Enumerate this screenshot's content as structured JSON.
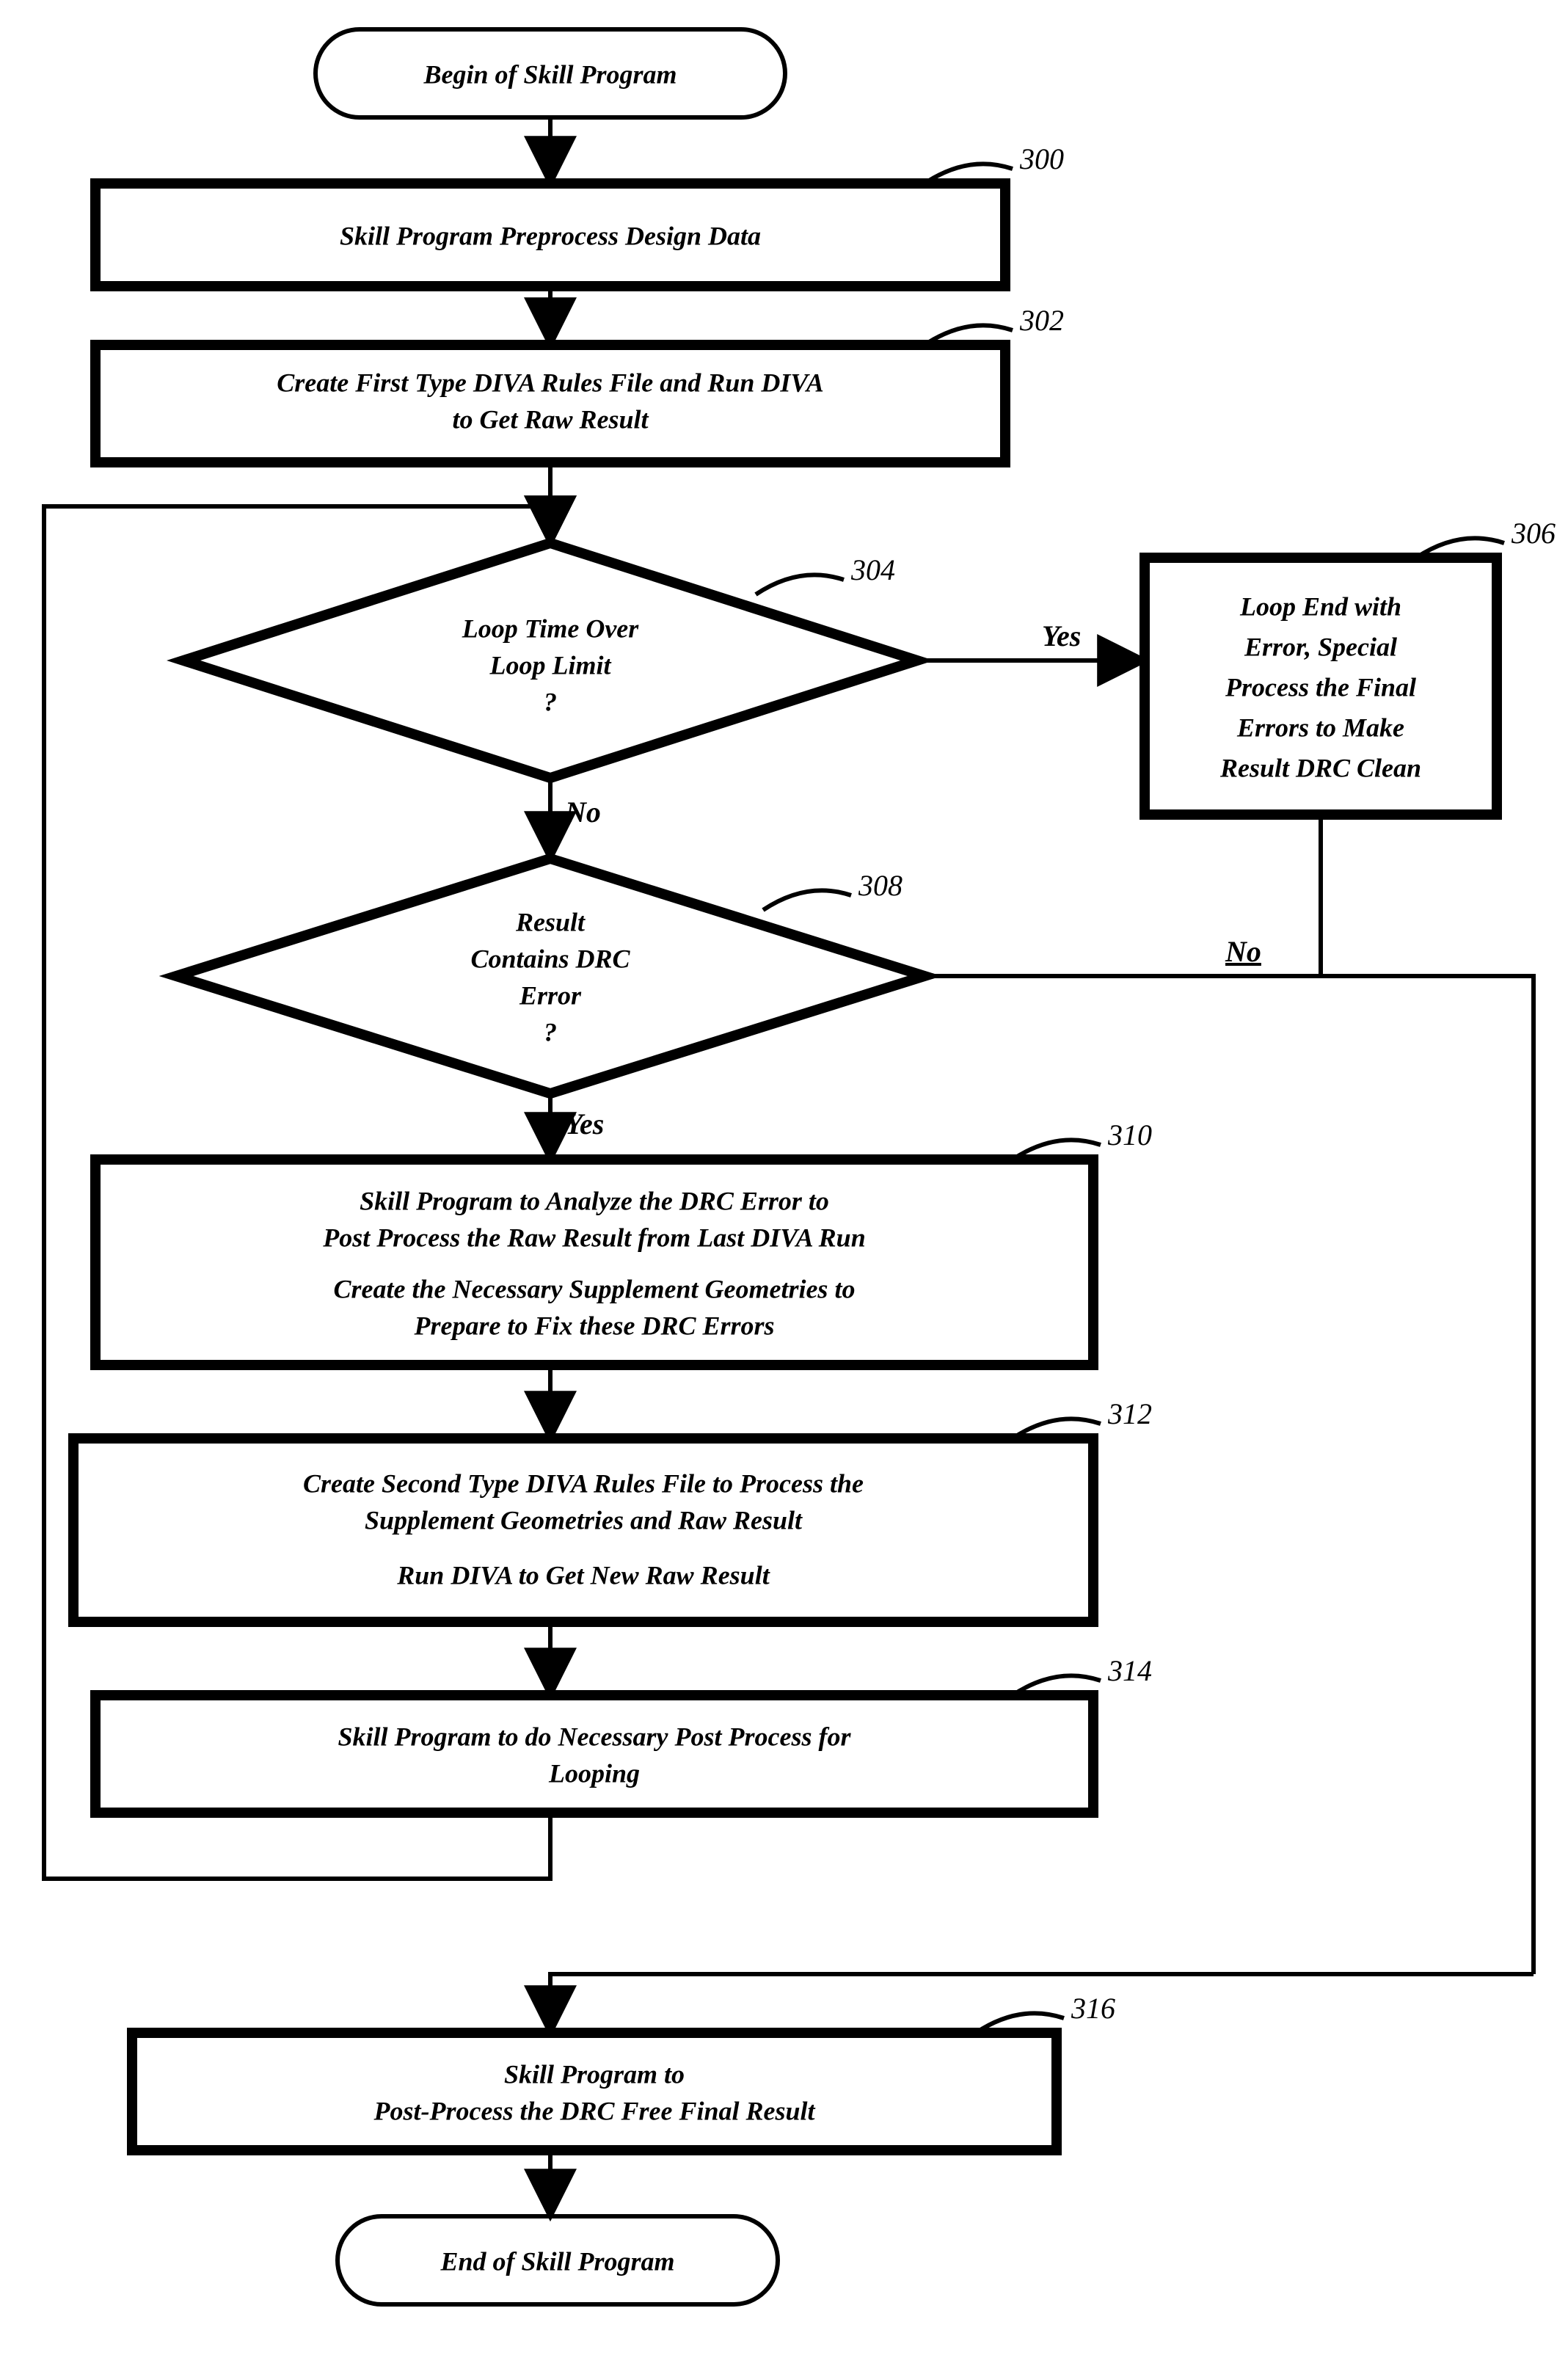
{
  "nodes": {
    "begin": {
      "text": "Begin of Skill Program"
    },
    "n300": {
      "ref": "300",
      "text": "Skill Program Preprocess Design Data"
    },
    "n302": {
      "ref": "302",
      "l1": "Create First Type DIVA Rules File and Run DIVA",
      "l2": "to Get Raw Result"
    },
    "n304": {
      "ref": "304",
      "l1": "Loop Time Over",
      "l2": "Loop Limit",
      "l3": "?"
    },
    "n306": {
      "ref": "306",
      "l1": "Loop End with",
      "l2": "Error, Special",
      "l3": "Process the Final",
      "l4": "Errors to Make",
      "l5": "Result DRC Clean"
    },
    "n308": {
      "ref": "308",
      "l1": "Result",
      "l2": "Contains DRC",
      "l3": "Error",
      "l4": "?"
    },
    "n310": {
      "ref": "310",
      "l1": "Skill Program to Analyze the DRC Error to",
      "l2": "Post Process the Raw Result from Last DIVA Run",
      "l3": "Create the Necessary Supplement Geometries to",
      "l4": "Prepare to Fix these DRC Errors"
    },
    "n312": {
      "ref": "312",
      "l1": "Create Second Type DIVA Rules File to Process the",
      "l2": "Supplement Geometries and Raw Result",
      "l3": "Run DIVA to Get New Raw Result"
    },
    "n314": {
      "ref": "314",
      "l1": "Skill Program to do Necessary Post Process for",
      "l2": "Looping"
    },
    "n316": {
      "ref": "316",
      "l1": "Skill Program to",
      "l2": "Post-Process the DRC Free Final Result"
    },
    "end": {
      "text": "End of Skill Program"
    }
  },
  "edges": {
    "yes": "Yes",
    "no": "No"
  }
}
